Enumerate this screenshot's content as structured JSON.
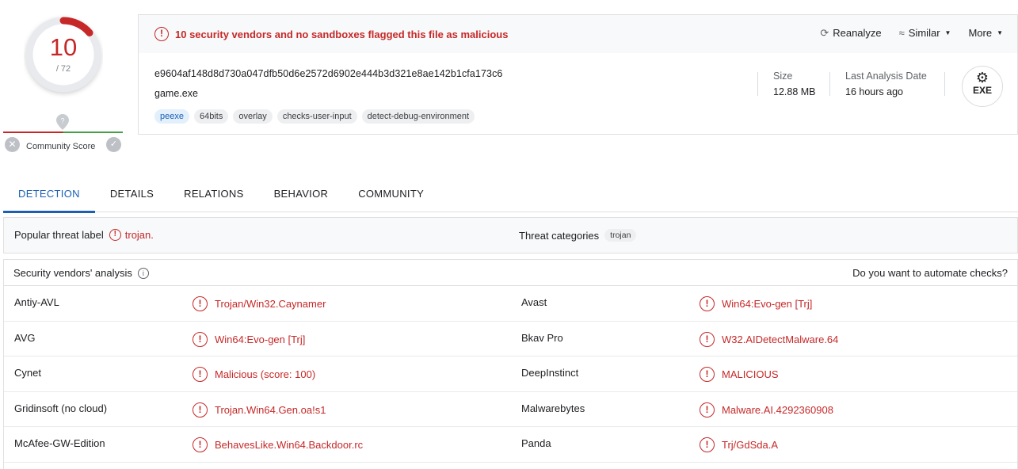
{
  "score": {
    "detections": "10",
    "total": "/ 72",
    "fraction": 0.139,
    "accent": "#c62828"
  },
  "community": {
    "label": "Community Score"
  },
  "summary": {
    "alert": "10 security vendors and no sandboxes flagged this file as malicious",
    "actions": {
      "reanalyze": "Reanalyze",
      "similar": "Similar",
      "more": "More"
    },
    "hash": "e9604af148d8d730a047dfb50d6e2572d6902e444b3d321e8ae142b1cfa173c6",
    "filename": "game.exe",
    "tags": [
      "peexe",
      "64bits",
      "overlay",
      "checks-user-input",
      "detect-debug-environment"
    ],
    "size_label": "Size",
    "size_value": "12.88 MB",
    "date_label": "Last Analysis Date",
    "date_value": "16 hours ago",
    "filetype": "EXE"
  },
  "tabs": [
    "DETECTION",
    "DETAILS",
    "RELATIONS",
    "BEHAVIOR",
    "COMMUNITY"
  ],
  "threat": {
    "popular_label": "Popular threat label",
    "popular_value": "trojan.",
    "categories_label": "Threat categories",
    "categories_value": "trojan"
  },
  "vendors": {
    "title": "Security vendors' analysis",
    "automate": "Do you want to automate checks?",
    "rows": [
      {
        "v1": "Antiy-AVL",
        "r1": "Trojan/Win32.Caynamer",
        "v2": "Avast",
        "r2": "Win64:Evo-gen [Trj]"
      },
      {
        "v1": "AVG",
        "r1": "Win64:Evo-gen [Trj]",
        "v2": "Bkav Pro",
        "r2": "W32.AIDetectMalware.64"
      },
      {
        "v1": "Cynet",
        "r1": "Malicious (score: 100)",
        "v2": "DeepInstinct",
        "r2": "MALICIOUS"
      },
      {
        "v1": "Gridinsoft (no cloud)",
        "r1": "Trojan.Win64.Gen.oa!s1",
        "v2": "Malwarebytes",
        "r2": "Malware.AI.4292360908"
      },
      {
        "v1": "McAfee-GW-Edition",
        "r1": "BehavesLike.Win64.Backdoor.rc",
        "v2": "Panda",
        "r2": "Trj/GdSda.A"
      }
    ]
  }
}
